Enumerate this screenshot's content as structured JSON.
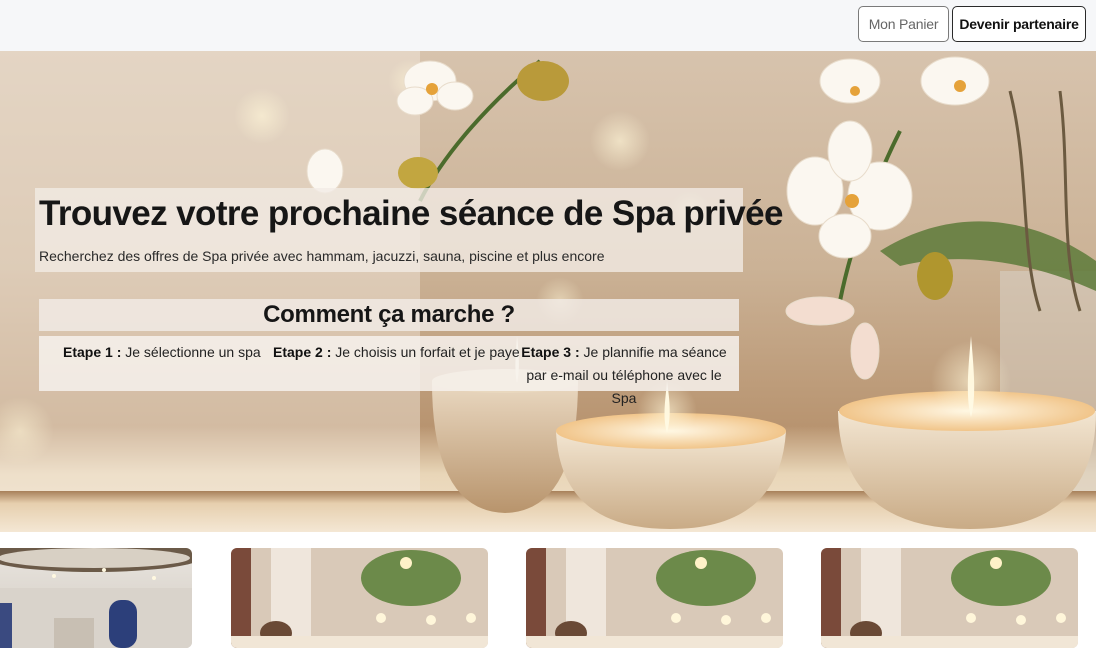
{
  "header": {
    "cart_button": "Mon Panier",
    "partner_button": "Devenir partenaire"
  },
  "hero": {
    "title": "Trouvez votre prochaine séance de Spa privée",
    "subtitle": "Recherchez des offres de Spa privée avec hammam, jacuzzi, sauna, piscine et plus encore",
    "how_title": "Comment ça marche ?",
    "steps": [
      {
        "label": "Etape 1 :",
        "text": "Je sélectionne un spa"
      },
      {
        "label": "Etape 2 :",
        "text": "Je choisis un forfait et je paye"
      },
      {
        "label": "Etape 3 :",
        "text": "Je plannifie ma séance par e-mail ou téléphone avec le Spa"
      }
    ]
  },
  "cards": [
    {
      "image": "hammam-interior"
    },
    {
      "image": "candles-and-plant"
    },
    {
      "image": "candles-and-plant"
    },
    {
      "image": "candles-and-plant"
    }
  ]
}
